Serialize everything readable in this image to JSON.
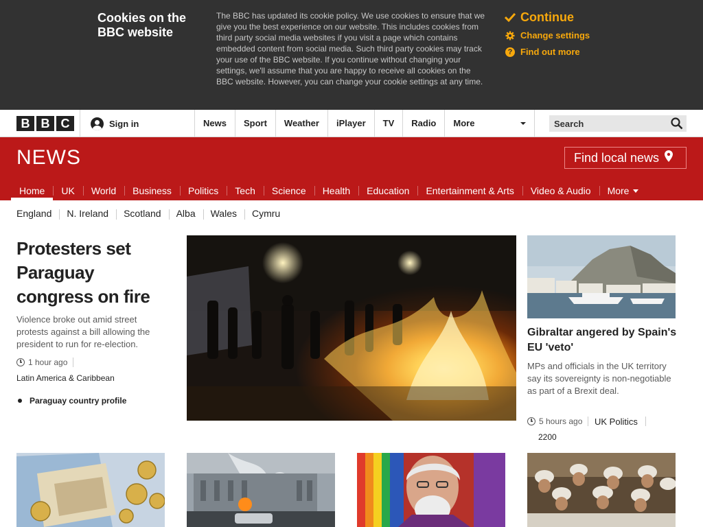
{
  "cookie": {
    "title": "Cookies on the BBC website",
    "text": "The BBC has updated its cookie policy. We use cookies to ensure that we give you the best experience on our website. This includes cookies from third party social media websites if you visit a page which contains embedded content from social media. Such third party cookies may track your use of the BBC website. If you continue without changing your settings, we'll assume that you are happy to receive all cookies on the BBC website. However, you can change your cookie settings at any time.",
    "continue_label": "Continue",
    "change_settings_label": "Change settings",
    "find_out_more_label": "Find out more",
    "accent_color": "#f7a80c"
  },
  "masthead": {
    "logo_letters": [
      "B",
      "B",
      "C"
    ],
    "sign_in_label": "Sign in",
    "nav": [
      {
        "label": "News"
      },
      {
        "label": "Sport"
      },
      {
        "label": "Weather"
      },
      {
        "label": "iPlayer"
      },
      {
        "label": "TV"
      },
      {
        "label": "Radio"
      }
    ],
    "more_label": "More",
    "search_placeholder": "Search"
  },
  "news": {
    "logo": "NEWS",
    "local_news_label": "Find local news",
    "brand_color": "#bb1919",
    "nav": [
      {
        "label": "Home",
        "active": true
      },
      {
        "label": "UK"
      },
      {
        "label": "World"
      },
      {
        "label": "Business"
      },
      {
        "label": "Politics"
      },
      {
        "label": "Tech"
      },
      {
        "label": "Science"
      },
      {
        "label": "Health"
      },
      {
        "label": "Education"
      },
      {
        "label": "Entertainment & Arts"
      },
      {
        "label": "Video & Audio"
      }
    ],
    "nav_more_label": "More",
    "subnav": [
      {
        "label": "England"
      },
      {
        "label": "N. Ireland"
      },
      {
        "label": "Scotland"
      },
      {
        "label": "Alba"
      },
      {
        "label": "Wales"
      },
      {
        "label": "Cymru"
      }
    ]
  },
  "lead": {
    "title": "Protesters set Paraguay congress on fire",
    "summary": "Violence broke out amid street protests against a bill allowing the president to run for re-election.",
    "time": "1 hour ago",
    "section": "Latin America & Caribbean",
    "related": "Paraguay country profile"
  },
  "side_story": {
    "title": "Gibraltar angered by Spain's EU 'veto'",
    "summary": "MPs and officials in the UK territory say its sovereignty is non-negotiable as part of a Brexit deal.",
    "time": "5 hours ago",
    "section": "UK Politics",
    "comments": "2200"
  }
}
